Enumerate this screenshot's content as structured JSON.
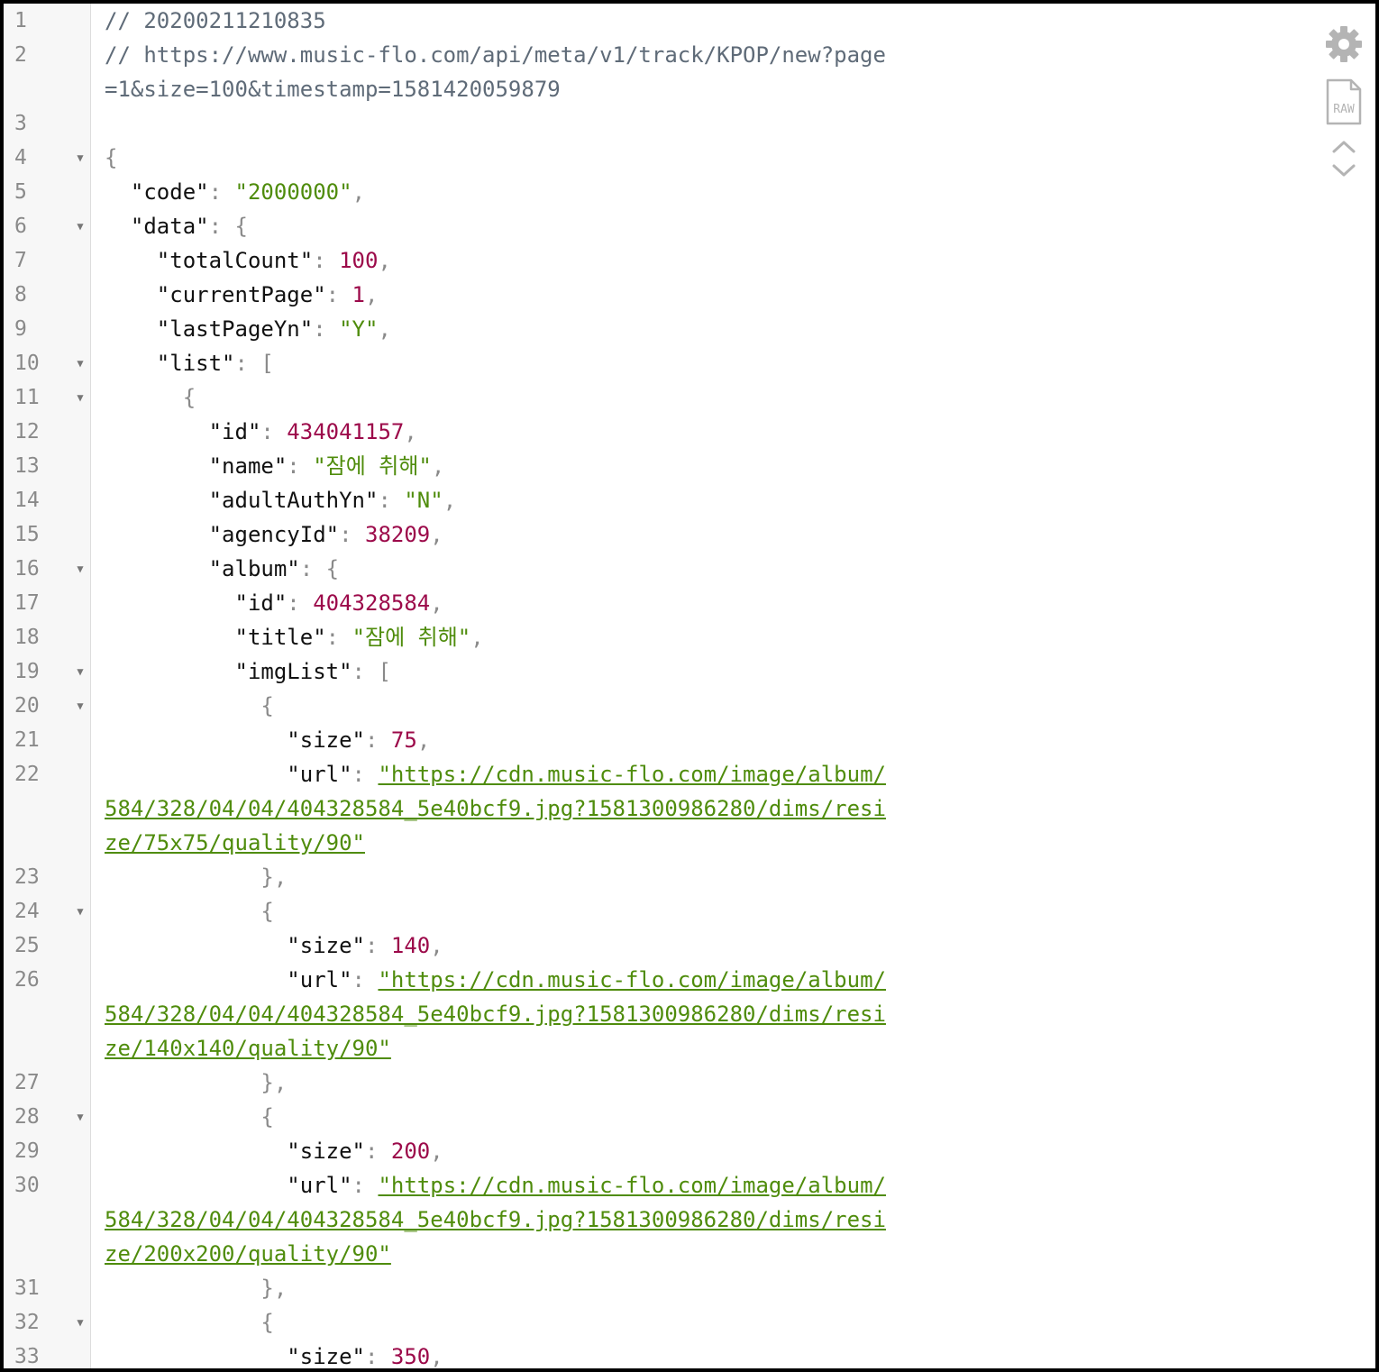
{
  "colors": {
    "string": "#4f8c0c",
    "number": "#9c0a4a",
    "comment": "#5f6b78",
    "gutter_bg": "#f7f7f7",
    "frame": "#000000"
  },
  "toolbar": {
    "icons": [
      "gear-icon",
      "raw-file-icon",
      "chevron-up-icon",
      "chevron-down-icon"
    ],
    "raw_label": "RAW"
  },
  "lines": [
    {
      "n": "1",
      "t": [
        [
          "cmt",
          "// 20200211210835"
        ]
      ]
    },
    {
      "n": "2",
      "t": [
        [
          "cmt",
          "// https://www.music-flo.com/api/meta/v1/track/KPOP/new?page=1&size=100&timestamp=1581420059879"
        ]
      ]
    },
    {
      "n": "3",
      "t": []
    },
    {
      "n": "4",
      "f": true,
      "t": [
        [
          "pun",
          "{"
        ]
      ]
    },
    {
      "n": "5",
      "t": [
        [
          "key",
          "  \"code\""
        ],
        [
          "pun",
          ": "
        ],
        [
          "str",
          "\"2000000\""
        ],
        [
          "pun",
          ","
        ]
      ]
    },
    {
      "n": "6",
      "f": true,
      "t": [
        [
          "key",
          "  \"data\""
        ],
        [
          "pun",
          ": {"
        ]
      ]
    },
    {
      "n": "7",
      "t": [
        [
          "key",
          "    \"totalCount\""
        ],
        [
          "pun",
          ": "
        ],
        [
          "num",
          "100"
        ],
        [
          "pun",
          ","
        ]
      ]
    },
    {
      "n": "8",
      "t": [
        [
          "key",
          "    \"currentPage\""
        ],
        [
          "pun",
          ": "
        ],
        [
          "num",
          "1"
        ],
        [
          "pun",
          ","
        ]
      ]
    },
    {
      "n": "9",
      "t": [
        [
          "key",
          "    \"lastPageYn\""
        ],
        [
          "pun",
          ": "
        ],
        [
          "str",
          "\"Y\""
        ],
        [
          "pun",
          ","
        ]
      ]
    },
    {
      "n": "10",
      "f": true,
      "t": [
        [
          "key",
          "    \"list\""
        ],
        [
          "pun",
          ": ["
        ]
      ]
    },
    {
      "n": "11",
      "f": true,
      "t": [
        [
          "pun",
          "      {"
        ]
      ]
    },
    {
      "n": "12",
      "t": [
        [
          "key",
          "        \"id\""
        ],
        [
          "pun",
          ": "
        ],
        [
          "num",
          "434041157"
        ],
        [
          "pun",
          ","
        ]
      ]
    },
    {
      "n": "13",
      "t": [
        [
          "key",
          "        \"name\""
        ],
        [
          "pun",
          ": "
        ],
        [
          "str",
          "\"잠에 취해\""
        ],
        [
          "pun",
          ","
        ]
      ]
    },
    {
      "n": "14",
      "t": [
        [
          "key",
          "        \"adultAuthYn\""
        ],
        [
          "pun",
          ": "
        ],
        [
          "str",
          "\"N\""
        ],
        [
          "pun",
          ","
        ]
      ]
    },
    {
      "n": "15",
      "t": [
        [
          "key",
          "        \"agencyId\""
        ],
        [
          "pun",
          ": "
        ],
        [
          "num",
          "38209"
        ],
        [
          "pun",
          ","
        ]
      ]
    },
    {
      "n": "16",
      "f": true,
      "t": [
        [
          "key",
          "        \"album\""
        ],
        [
          "pun",
          ": {"
        ]
      ]
    },
    {
      "n": "17",
      "t": [
        [
          "key",
          "          \"id\""
        ],
        [
          "pun",
          ": "
        ],
        [
          "num",
          "404328584"
        ],
        [
          "pun",
          ","
        ]
      ]
    },
    {
      "n": "18",
      "t": [
        [
          "key",
          "          \"title\""
        ],
        [
          "pun",
          ": "
        ],
        [
          "str",
          "\"잠에 취해\""
        ],
        [
          "pun",
          ","
        ]
      ]
    },
    {
      "n": "19",
      "f": true,
      "t": [
        [
          "key",
          "          \"imgList\""
        ],
        [
          "pun",
          ": ["
        ]
      ]
    },
    {
      "n": "20",
      "f": true,
      "t": [
        [
          "pun",
          "            {"
        ]
      ]
    },
    {
      "n": "21",
      "t": [
        [
          "key",
          "              \"size\""
        ],
        [
          "pun",
          ": "
        ],
        [
          "num",
          "75"
        ],
        [
          "pun",
          ","
        ]
      ]
    },
    {
      "n": "22",
      "t": [
        [
          "key",
          "              \"url\""
        ],
        [
          "pun",
          ": "
        ],
        [
          "url",
          "\"https://cdn.music-flo.com/image/album/584/328/04/04/404328584_5e40bcf9.jpg?1581300986280/dims/resize/75x75/quality/90\""
        ]
      ]
    },
    {
      "n": "23",
      "t": [
        [
          "pun",
          "            },"
        ]
      ]
    },
    {
      "n": "24",
      "f": true,
      "t": [
        [
          "pun",
          "            {"
        ]
      ]
    },
    {
      "n": "25",
      "t": [
        [
          "key",
          "              \"size\""
        ],
        [
          "pun",
          ": "
        ],
        [
          "num",
          "140"
        ],
        [
          "pun",
          ","
        ]
      ]
    },
    {
      "n": "26",
      "t": [
        [
          "key",
          "              \"url\""
        ],
        [
          "pun",
          ": "
        ],
        [
          "url",
          "\"https://cdn.music-flo.com/image/album/584/328/04/04/404328584_5e40bcf9.jpg?1581300986280/dims/resize/140x140/quality/90\""
        ]
      ]
    },
    {
      "n": "27",
      "t": [
        [
          "pun",
          "            },"
        ]
      ]
    },
    {
      "n": "28",
      "f": true,
      "t": [
        [
          "pun",
          "            {"
        ]
      ]
    },
    {
      "n": "29",
      "t": [
        [
          "key",
          "              \"size\""
        ],
        [
          "pun",
          ": "
        ],
        [
          "num",
          "200"
        ],
        [
          "pun",
          ","
        ]
      ]
    },
    {
      "n": "30",
      "t": [
        [
          "key",
          "              \"url\""
        ],
        [
          "pun",
          ": "
        ],
        [
          "url",
          "\"https://cdn.music-flo.com/image/album/584/328/04/04/404328584_5e40bcf9.jpg?1581300986280/dims/resize/200x200/quality/90\""
        ]
      ]
    },
    {
      "n": "31",
      "t": [
        [
          "pun",
          "            },"
        ]
      ]
    },
    {
      "n": "32",
      "f": true,
      "t": [
        [
          "pun",
          "            {"
        ]
      ]
    },
    {
      "n": "33",
      "t": [
        [
          "key",
          "              \"size\""
        ],
        [
          "pun",
          ": "
        ],
        [
          "num",
          "350"
        ],
        [
          "pun",
          ","
        ]
      ]
    }
  ]
}
